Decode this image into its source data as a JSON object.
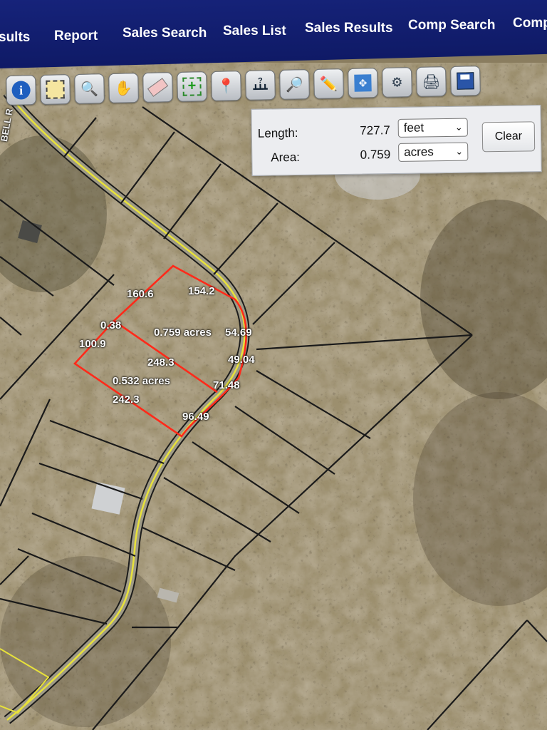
{
  "nav": {
    "items": [
      "sults",
      "Report",
      "Sales Search",
      "Sales List",
      "Sales Results",
      "Comp Search",
      "Comp"
    ]
  },
  "toolbar": {
    "tools": [
      "info-icon",
      "select-parcel-icon",
      "zoom-in-icon",
      "pan-hand-icon",
      "eraser-icon",
      "add-parcel-icon",
      "pin-icon",
      "measure-icon",
      "zoom-out-icon",
      "pencil-icon",
      "full-extent-icon",
      "buffer-icon",
      "print-icon",
      "save-icon"
    ]
  },
  "measure": {
    "length_label": "Length:",
    "length_value": "727.7",
    "length_unit": "feet",
    "area_label": "Area:",
    "area_value": "0.759",
    "area_unit": "acres",
    "clear_label": "Clear"
  },
  "map": {
    "road_label": "BELL R",
    "dimensions": {
      "d160": "160.6",
      "d154": "154.2",
      "d038": "0.38",
      "acres759": "0.759 acres",
      "d5469": "54.69",
      "d1009": "100.9",
      "d4904": "49.04",
      "d2483": "248.3",
      "acres532": "0.532 acres",
      "d7148": "71.48",
      "d2423": "242.3",
      "d9649": "96.49"
    },
    "colors": {
      "parcel": "#1a1a1a",
      "selection": "#ff2a1a",
      "road": "#e8e23a"
    }
  }
}
